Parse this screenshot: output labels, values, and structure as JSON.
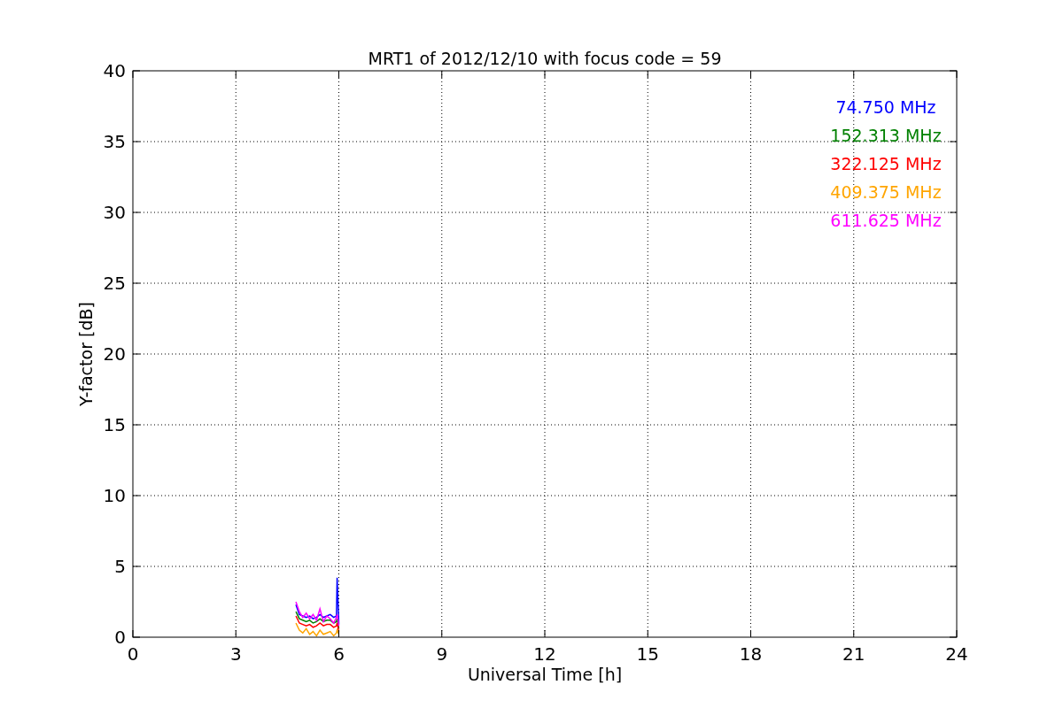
{
  "chart_data": {
    "type": "line",
    "title": "MRT1 of 2012/12/10 with focus code = 59",
    "xlabel": "Universal Time [h]",
    "ylabel": "Y-factor [dB]",
    "x": [
      4.75,
      4.85,
      4.95,
      5.05,
      5.15,
      5.25,
      5.35,
      5.45,
      5.55,
      5.65,
      5.75,
      5.85,
      5.93,
      5.95,
      6.0
    ],
    "series": [
      {
        "name": "74.750 MHz",
        "color": "#0000ff",
        "values": [
          2.3,
          1.6,
          1.5,
          1.4,
          1.5,
          1.3,
          1.4,
          1.6,
          1.4,
          1.5,
          1.6,
          1.4,
          1.5,
          4.2,
          0.9
        ]
      },
      {
        "name": "152.313 MHz",
        "color": "#008000",
        "values": [
          1.8,
          1.3,
          1.2,
          1.1,
          1.2,
          1.0,
          1.1,
          1.3,
          1.1,
          1.2,
          1.2,
          1.0,
          1.1,
          1.3,
          0.6
        ]
      },
      {
        "name": "322.125 MHz",
        "color": "#ff0000",
        "values": [
          1.5,
          1.0,
          0.9,
          0.8,
          0.9,
          0.7,
          0.8,
          1.0,
          0.8,
          0.9,
          0.9,
          0.7,
          0.8,
          1.0,
          0.4
        ]
      },
      {
        "name": "409.375 MHz",
        "color": "#ffa500",
        "values": [
          1.0,
          0.5,
          0.3,
          0.6,
          0.2,
          0.4,
          0.1,
          0.5,
          0.2,
          0.3,
          0.4,
          0.1,
          0.3,
          0.5,
          0.2
        ]
      },
      {
        "name": "611.625 MHz",
        "color": "#ff00ff",
        "values": [
          2.5,
          1.8,
          1.4,
          1.7,
          1.3,
          1.6,
          1.2,
          2.0,
          1.1,
          1.5,
          1.3,
          1.0,
          1.4,
          1.6,
          0.8
        ]
      }
    ],
    "xlim": [
      0,
      24
    ],
    "ylim": [
      0,
      40
    ],
    "xticks": [
      0,
      3,
      6,
      9,
      12,
      15,
      18,
      21,
      24
    ],
    "yticks": [
      0,
      5,
      10,
      15,
      20,
      25,
      30,
      35,
      40
    ],
    "grid": true
  }
}
